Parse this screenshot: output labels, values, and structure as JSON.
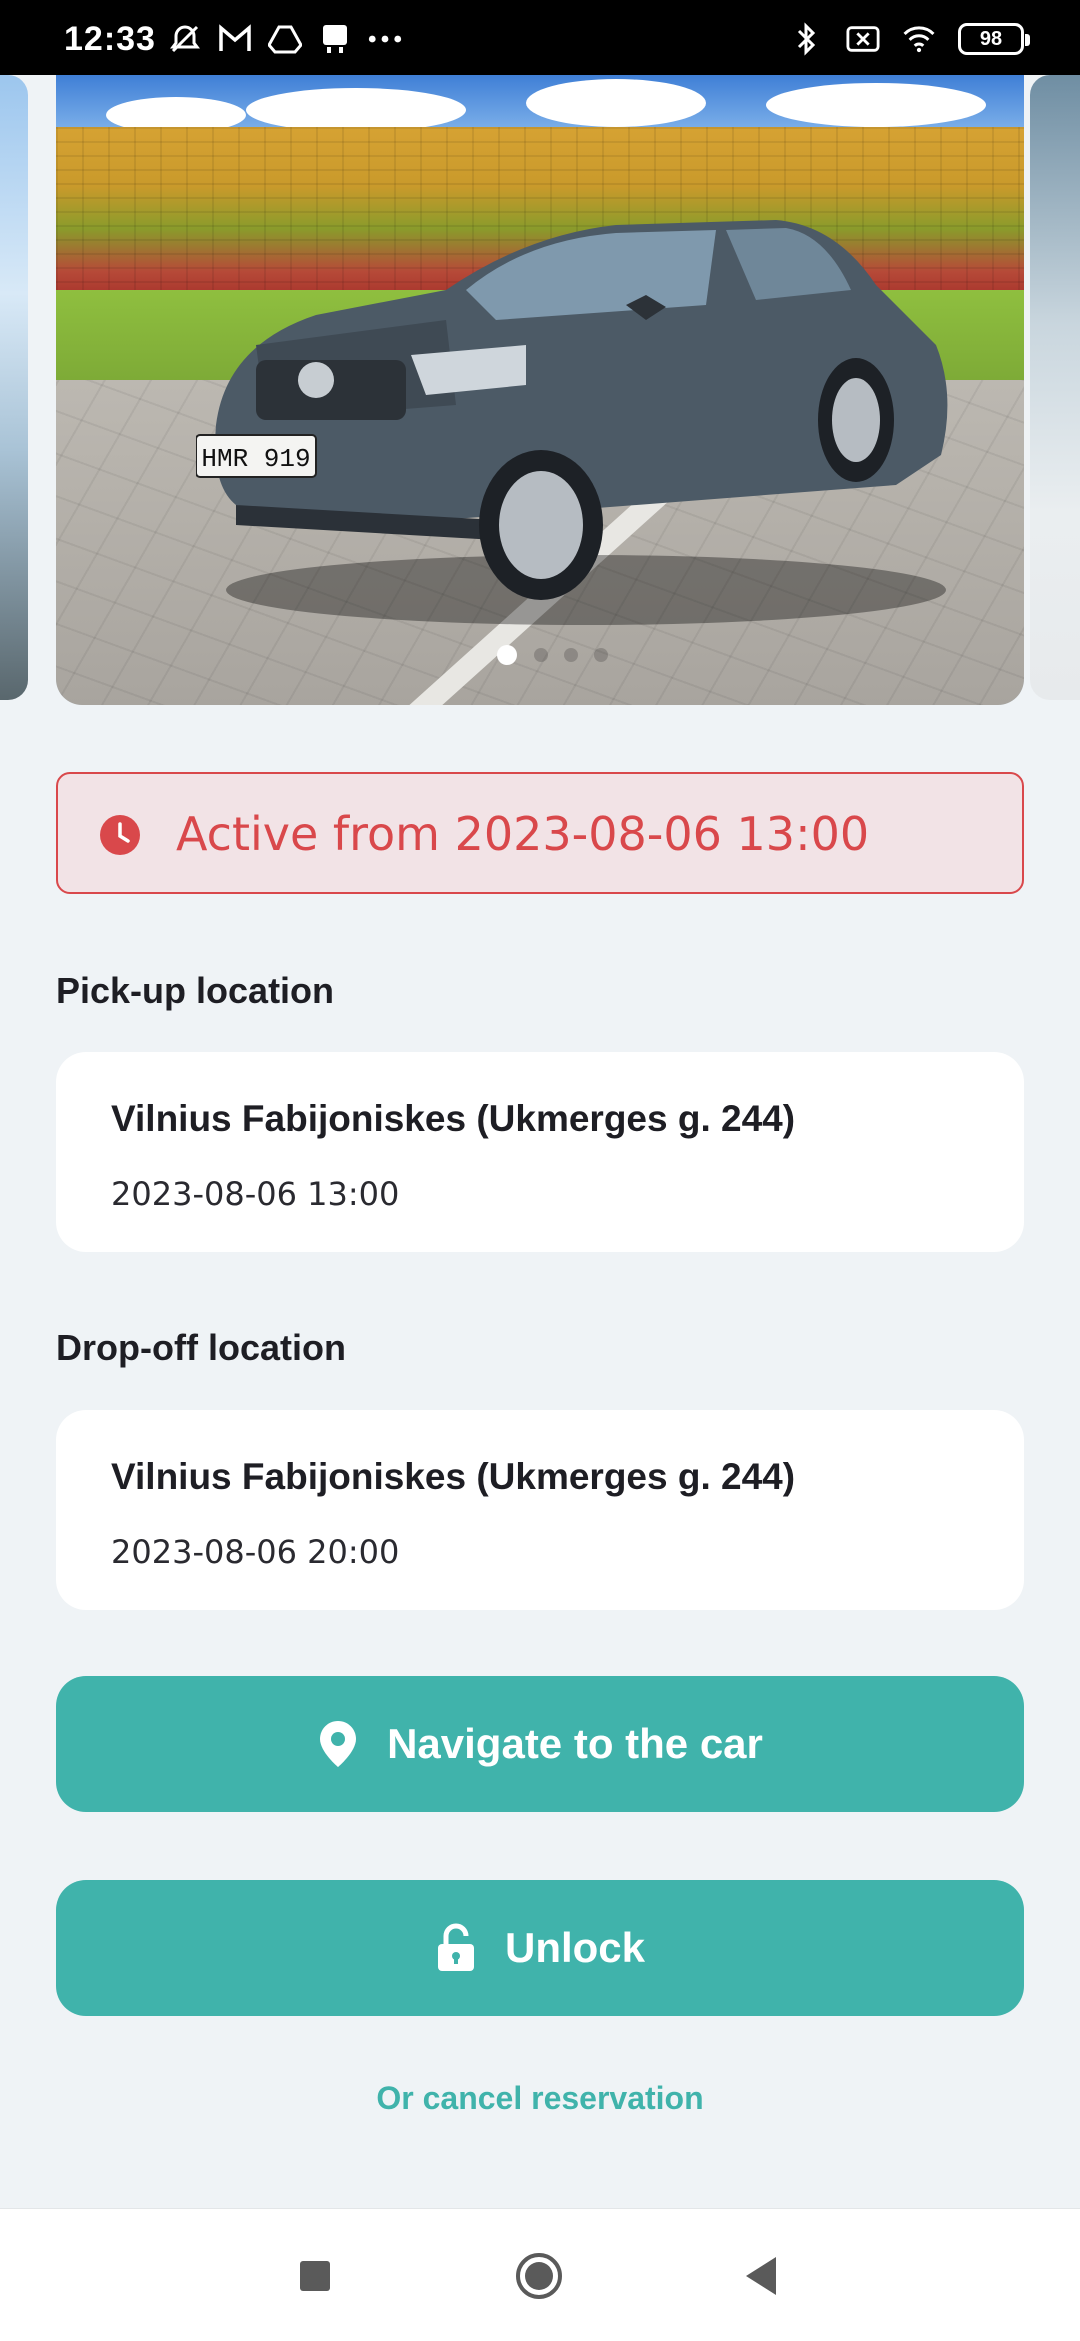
{
  "status_bar": {
    "time": "12:33",
    "battery": "98",
    "left_icons": [
      "mute-alarm-icon",
      "gmail-icon",
      "drive-icon",
      "tray-icon",
      "more-dots-icon"
    ],
    "right_icons": [
      "bluetooth-icon",
      "sim-x-icon",
      "wifi-icon",
      "battery-icon"
    ]
  },
  "carousel": {
    "image_alt": "Grey Volkswagen station wagon parked in front of a colorful wall",
    "plate_text": "HMR 919",
    "page_index": 1
  },
  "alert": {
    "icon": "clock-icon",
    "text": "Active from 2023-08-06 13:00",
    "color": "#d9484b"
  },
  "pickup": {
    "label": "Pick-up location",
    "location": "Vilnius Fabijoniskes (Ukmerges g. 244)",
    "datetime": "2023-08-06 13:00"
  },
  "dropoff": {
    "label": "Drop-off location",
    "location": "Vilnius Fabijoniskes (Ukmerges g. 244)",
    "datetime": "2023-08-06 20:00"
  },
  "actions": {
    "navigate_label": "Navigate to the car",
    "navigate_icon": "location-pin-icon",
    "unlock_label": "Unlock",
    "unlock_icon": "lock-icon",
    "cancel_label": "Or cancel reservation",
    "accent_color": "#40b3ab"
  },
  "nav_bar": {
    "buttons": [
      "recents",
      "home",
      "back"
    ]
  }
}
